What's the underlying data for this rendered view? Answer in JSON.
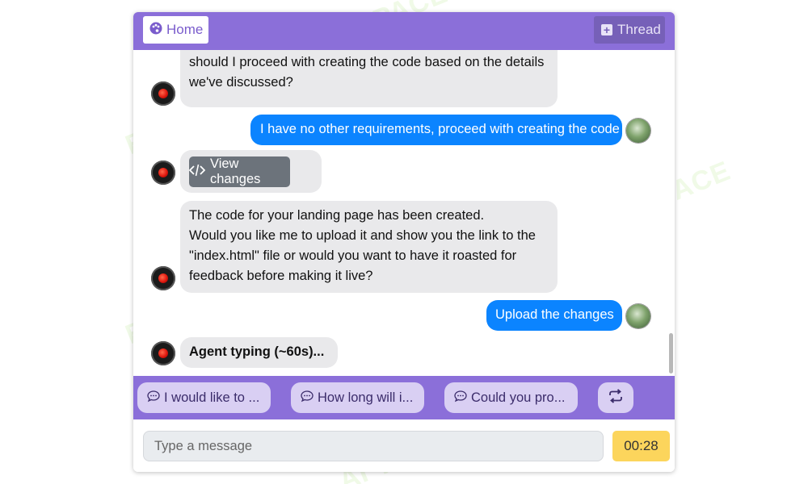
{
  "header": {
    "home_label": "Home",
    "thread_label": "Thread"
  },
  "messages": [
    {
      "role": "agent",
      "text_lines": [
        "should I proceed with creating the code based on the details",
        "we've discussed?"
      ]
    },
    {
      "role": "user",
      "text": "I have no other requirements, proceed with creating the code"
    },
    {
      "role": "agent",
      "button_label": "View changes"
    },
    {
      "role": "agent",
      "text_lines": [
        "The code for your landing page has been created.",
        "Would you like me to upload it and show you the link to the",
        "\"index.html\" file or would you want to have it roasted for",
        "feedback before making it live?"
      ]
    },
    {
      "role": "user",
      "text": "Upload the changes"
    },
    {
      "role": "agent",
      "text": "Agent typing (~60s)..."
    }
  ],
  "suggestions": [
    {
      "label": "I would like to ..."
    },
    {
      "label": "How long will i..."
    },
    {
      "label": "Could you pro..."
    }
  ],
  "input": {
    "placeholder": "Type a message",
    "value": ""
  },
  "timer": "00:28",
  "colors": {
    "accent": "#8b6fd9",
    "user_bubble": "#0b84ff",
    "agent_bubble": "#e9e9eb",
    "timer": "#fcd55c"
  },
  "watermark": {
    "text": "AI TALENT SPACE",
    "fragment": "ENT SPACE"
  },
  "icons": [
    "palette-icon",
    "plus-square-icon",
    "code-icon",
    "chat-bubble-icon",
    "repeat-icon",
    "bot-avatar-icon",
    "user-avatar-icon"
  ]
}
